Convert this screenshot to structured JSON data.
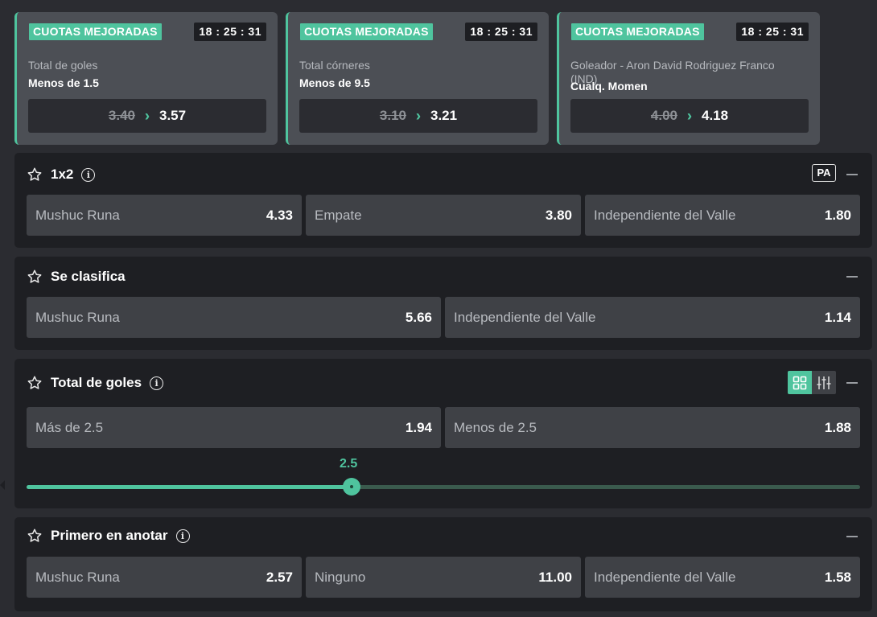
{
  "promos": [
    {
      "badge": "CUOTAS MEJORADAS",
      "timer": "18 : 25 : 31",
      "market": "Total de goles",
      "selection": "Menos de 1.5",
      "old_odd": "3.40",
      "new_odd": "3.57"
    },
    {
      "badge": "CUOTAS MEJORADAS",
      "timer": "18 : 25 : 31",
      "market": "Total córneres",
      "selection": "Menos de 9.5",
      "old_odd": "3.10",
      "new_odd": "3.21"
    },
    {
      "badge": "CUOTAS MEJORADAS",
      "timer": "18 : 25 : 31",
      "market": "Goleador - Aron David Rodriguez Franco (IND)",
      "selection": "Cualq. Momen",
      "old_odd": "4.00",
      "new_odd": "4.18"
    }
  ],
  "markets": {
    "m1x2": {
      "title": "1x2",
      "pa_label": "PA",
      "outcomes": [
        {
          "name": "Mushuc Runa",
          "odd": "4.33"
        },
        {
          "name": "Empate",
          "odd": "3.80"
        },
        {
          "name": "Independiente del Valle",
          "odd": "1.80"
        }
      ]
    },
    "clasifica": {
      "title": "Se clasifica",
      "outcomes": [
        {
          "name": "Mushuc Runa",
          "odd": "5.66"
        },
        {
          "name": "Independiente del Valle",
          "odd": "1.14"
        }
      ]
    },
    "total": {
      "title": "Total de goles",
      "outcomes": [
        {
          "name": "Más de 2.5",
          "odd": "1.94"
        },
        {
          "name": "Menos de 2.5",
          "odd": "1.88"
        }
      ],
      "slider_label": "2.5",
      "slider_fraction": 0.39
    },
    "primero": {
      "title": "Primero en anotar",
      "outcomes": [
        {
          "name": "Mushuc Runa",
          "odd": "2.57"
        },
        {
          "name": "Ninguno",
          "odd": "11.00"
        },
        {
          "name": "Independiente del Valle",
          "odd": "1.58"
        }
      ]
    }
  },
  "colors": {
    "accent": "#4fc49e",
    "card": "#3f4146",
    "panel": "#1e1f23"
  },
  "icons": {
    "star": "star-outline-icon",
    "info": "info-circle-icon",
    "collapse": "minus-icon",
    "arrow": "double-chevron-right-icon",
    "grid": "grid-view-icon",
    "sliders": "sliders-view-icon"
  }
}
